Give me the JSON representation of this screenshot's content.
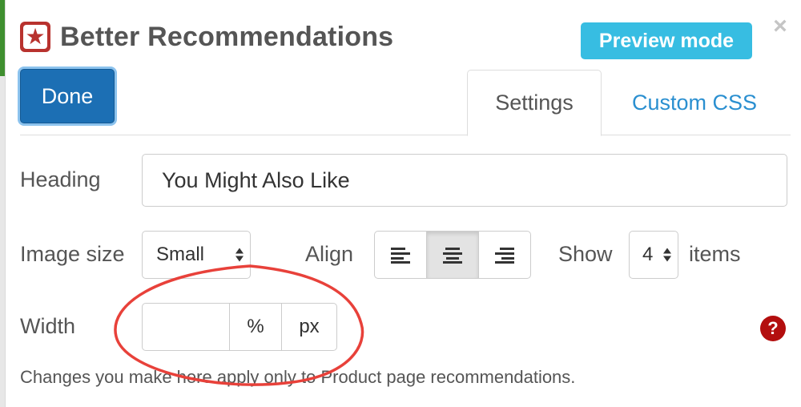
{
  "app": {
    "title": "Better Recommendations",
    "logo_icon": "star-icon"
  },
  "header": {
    "preview_label": "Preview mode",
    "close_symbol": "×",
    "done_label": "Done"
  },
  "tabs": [
    {
      "label": "Settings",
      "active": true
    },
    {
      "label": "Custom CSS",
      "active": false
    }
  ],
  "form": {
    "heading_label": "Heading",
    "heading_value": "You Might Also Like",
    "image_size_label": "Image size",
    "image_size_value": "Small",
    "align_label": "Align",
    "align_selected": "center",
    "show_label": "Show",
    "show_value": "4",
    "items_label": "items",
    "width_label": "Width",
    "width_value": "",
    "unit_percent": "%",
    "unit_px": "px",
    "help_symbol": "?"
  },
  "note": "Changes you make here apply only to Product page recommendations.",
  "colors": {
    "accent": "#37bde2",
    "primary": "#1c6fb4",
    "link": "#2a8fd0",
    "danger": "#b30e0e",
    "annotation": "#e8413a"
  }
}
